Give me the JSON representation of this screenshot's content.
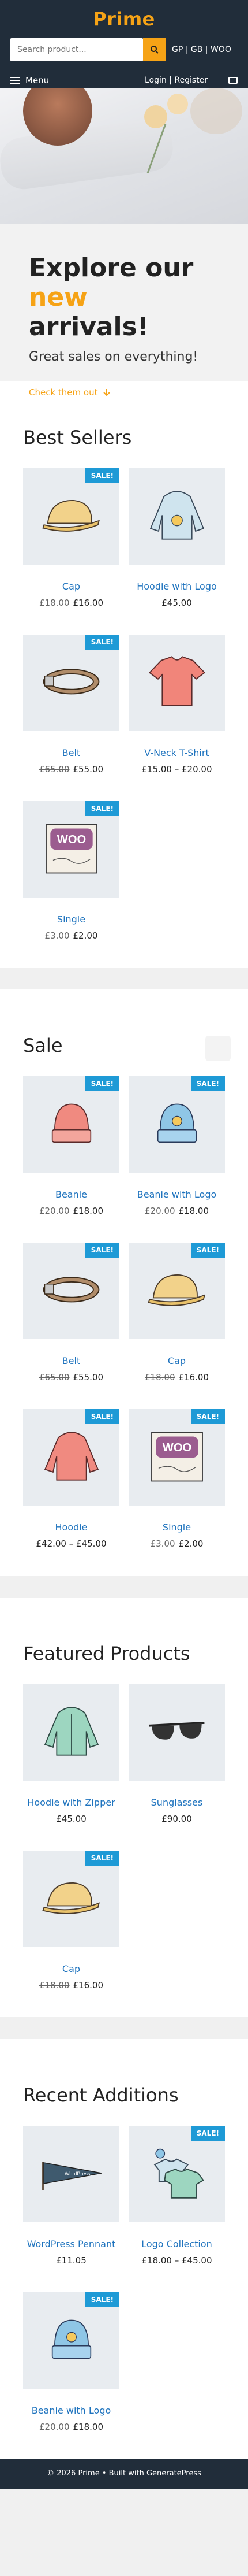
{
  "header": {
    "brand": "Prime",
    "search_placeholder": "Search product...",
    "currency": "GP | GB | WOO",
    "menu_label": "Menu",
    "account": "Login | Register",
    "cart_icon": "cart-icon"
  },
  "hero": {
    "title_line1": "Explore our",
    "title_accent": "new",
    "title_line2": "arrivals!",
    "subtitle": "Great sales on everything!",
    "cta": "Check them out"
  },
  "sections": {
    "best_sellers": {
      "title": "Best Sellers",
      "items": [
        {
          "name": "Cap",
          "old": "£18.00",
          "price": "£16.00",
          "sale": "SALE!",
          "icon": "cap"
        },
        {
          "name": "Hoodie with Logo",
          "old": "",
          "price": "£45.00",
          "sale": "",
          "icon": "hoodie-logo"
        },
        {
          "name": "Belt",
          "old": "£65.00",
          "price": "£55.00",
          "sale": "SALE!",
          "icon": "belt"
        },
        {
          "name": "V-Neck T-Shirt",
          "old": "",
          "price": "£15.00 – £20.00",
          "sale": "",
          "icon": "tshirt"
        },
        {
          "name": "Single",
          "old": "£3.00",
          "price": "£2.00",
          "sale": "SALE!",
          "icon": "single"
        }
      ]
    },
    "sale": {
      "title": "Sale",
      "items": [
        {
          "name": "Beanie",
          "old": "£20.00",
          "price": "£18.00",
          "sale": "SALE!",
          "icon": "beanie"
        },
        {
          "name": "Beanie with Logo",
          "old": "£20.00",
          "price": "£18.00",
          "sale": "SALE!",
          "icon": "beanie-logo"
        },
        {
          "name": "Belt",
          "old": "£65.00",
          "price": "£55.00",
          "sale": "SALE!",
          "icon": "belt"
        },
        {
          "name": "Cap",
          "old": "£18.00",
          "price": "£16.00",
          "sale": "SALE!",
          "icon": "cap"
        },
        {
          "name": "Hoodie",
          "old": "",
          "price": "£42.00 – £45.00",
          "sale": "SALE!",
          "icon": "hoodie"
        },
        {
          "name": "Single",
          "old": "£3.00",
          "price": "£2.00",
          "sale": "SALE!",
          "icon": "single"
        }
      ]
    },
    "featured": {
      "title": "Featured Products",
      "items": [
        {
          "name": "Hoodie with Zipper",
          "old": "",
          "price": "£45.00",
          "sale": "",
          "icon": "hoodie-zip"
        },
        {
          "name": "Sunglasses",
          "old": "",
          "price": "£90.00",
          "sale": "",
          "icon": "sunglasses"
        },
        {
          "name": "Cap",
          "old": "£18.00",
          "price": "£16.00",
          "sale": "SALE!",
          "icon": "cap"
        }
      ]
    },
    "recent": {
      "title": "Recent Additions",
      "items": [
        {
          "name": "WordPress Pennant",
          "old": "",
          "price": "£11.05",
          "sale": "",
          "icon": "pennant"
        },
        {
          "name": "Logo Collection",
          "old": "",
          "price": "£18.00 – £45.00",
          "sale": "SALE!",
          "icon": "logo-collection"
        },
        {
          "name": "Beanie with Logo",
          "old": "£20.00",
          "price": "£18.00",
          "sale": "SALE!",
          "icon": "beanie-logo"
        }
      ]
    }
  },
  "footer": {
    "text": "© 2026 Prime • Built with GeneratePress"
  },
  "colors": {
    "header": "#212d3a",
    "accent": "#f6a316",
    "link": "#1e73be",
    "sale": "#1e9ad6"
  }
}
